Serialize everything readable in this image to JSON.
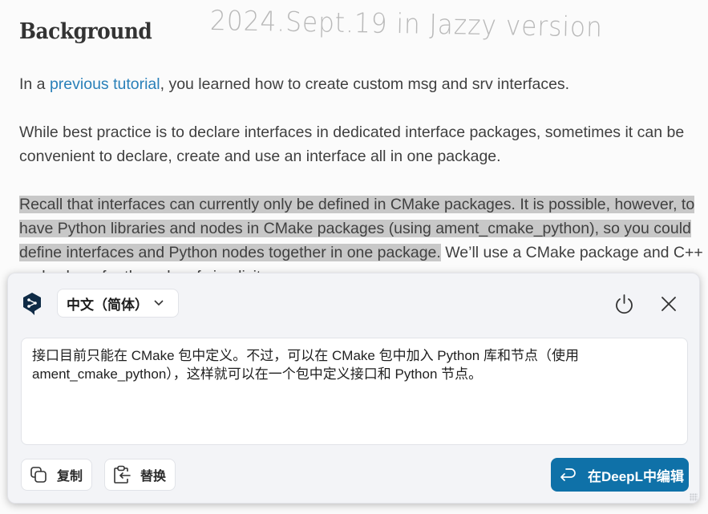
{
  "document": {
    "heading": "Background",
    "handwritten_note": "2024.Sept.19   in Jazzy version",
    "paragraph1": {
      "before_link": "In a ",
      "link_text": "previous tutorial",
      "after_link": ", you learned how to create custom msg and srv interfaces."
    },
    "paragraph2": {
      "line1": "While best practice is to declare interfaces in dedicated interface packages, sometimes it can be",
      "line2": "convenient to declare, create and use an interface all in one package."
    },
    "paragraph3": {
      "line1_selected": "Recall that interfaces can currently only be defined in CMake packages. It is possible, however, to",
      "line2_selected": "have Python libraries and nodes in CMake packages (using ament_cmake_python), so you could",
      "line3_selected": "define interfaces and Python nodes together in one package.",
      "line3_rest": " We’ll use a CMake package and C++",
      "line4_partial": "nodes here for the sake of simplicity."
    }
  },
  "translator_popup": {
    "brand_icon": "deepl-logo-icon",
    "target_language": "中文（简体）",
    "translation_line1": "接口目前只能在 CMake 包中定义。不过，可以在 CMake 包中加入 Python 库和节点（使用",
    "translation_line2": "ament_cmake_python），这样就可以在一个包中定义接口和 Python 节点。",
    "buttons": {
      "copy": "复制",
      "replace": "替换",
      "edit_in_deepl": "在DeepL中编辑"
    },
    "colors": {
      "accent": "#0f71a8",
      "logo": "#0f2b46"
    }
  }
}
